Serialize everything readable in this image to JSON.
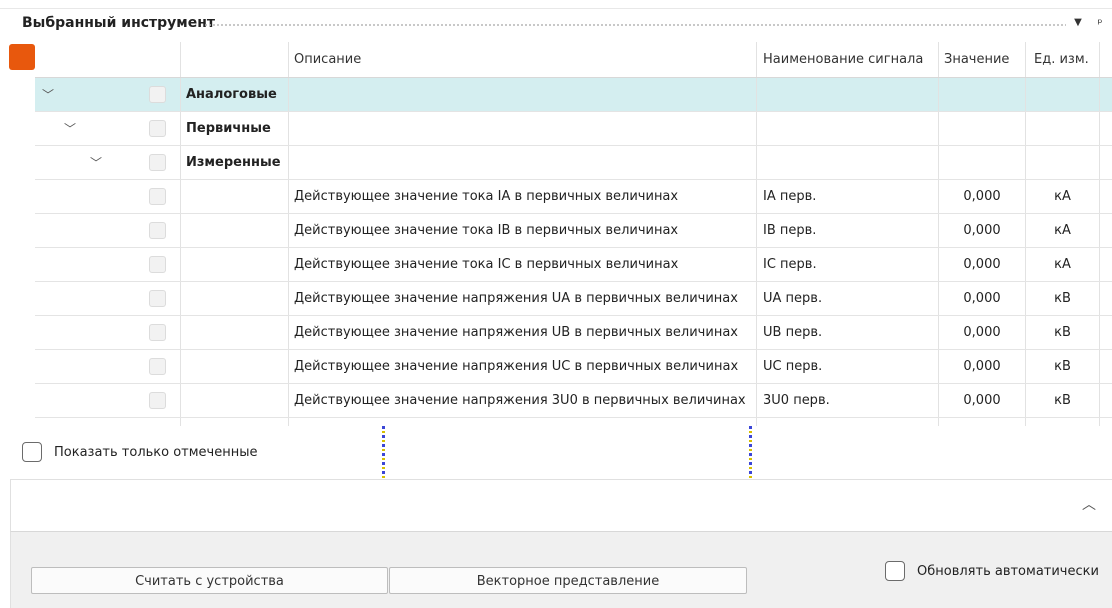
{
  "panel": {
    "title": "Выбранный инструмент",
    "dropdown_icon": "triangle-down-icon",
    "pin_icon": "pin-icon"
  },
  "grid": {
    "columns": {
      "description": "Описание",
      "signal_name": "Наименование сигнала",
      "value": "Значение",
      "unit": "Ед. изм."
    },
    "groups": [
      {
        "label": "Аналоговые",
        "level": 0,
        "expanded": true
      },
      {
        "label": "Первичные",
        "level": 1,
        "expanded": true
      },
      {
        "label": "Измеренные",
        "level": 2,
        "expanded": true
      }
    ],
    "rows": [
      {
        "description": "Действующее значение тока IA в первичных величинах",
        "signal": "IA перв.",
        "value": "0,000",
        "unit": "кА"
      },
      {
        "description": "Действующее значение тока IB в первичных величинах",
        "signal": "IB перв.",
        "value": "0,000",
        "unit": "кА"
      },
      {
        "description": "Действующее значение тока IC в первичных величинах",
        "signal": "IC перв.",
        "value": "0,000",
        "unit": "кА"
      },
      {
        "description": "Действующее значение напряжения UA в первичных величинах",
        "signal": "UA перв.",
        "value": "0,000",
        "unit": "кВ"
      },
      {
        "description": "Действующее значение напряжения UB в первичных величинах",
        "signal": "UB перв.",
        "value": "0,000",
        "unit": "кВ"
      },
      {
        "description": "Действующее значение напряжения UC в первичных величинах",
        "signal": "UC перв.",
        "value": "0,000",
        "unit": "кВ"
      },
      {
        "description": "Действующее значение напряжения 3U0 в первичных величинах",
        "signal": "3U0 перв.",
        "value": "0,000",
        "unit": "кВ"
      }
    ],
    "accent_color": "#e8580d",
    "selected_row_color": "#d4eef0"
  },
  "filters": {
    "show_only_checked": "Показать только отмеченные"
  },
  "footer": {
    "read_button": "Считать с устройства",
    "vector_button": "Векторное представление",
    "auto_update": "Обновлять автоматически"
  }
}
